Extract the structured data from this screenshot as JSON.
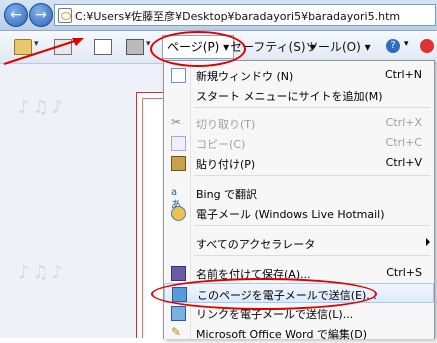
{
  "address_bar": {
    "url": "C:¥Users¥佐藤至彦¥Desktop¥baradayori5¥baradayori5.htm",
    "back_glyph": "←",
    "forward_glyph": "→"
  },
  "command_bar": {
    "page_menu_label": "ページ(P) ▾",
    "safety_menu_label": "セーフティ(S) ▾",
    "tools_menu_label": "ツール(O) ▾",
    "help_glyph": "?",
    "arrow_glyph": "▾"
  },
  "page": {
    "music_decor": "♪♫♪"
  },
  "page_menu": {
    "items": [
      {
        "label": "新規ウィンドウ (N)",
        "shortcut": "Ctrl+N",
        "icon": "new-window-icon",
        "disabled": false
      },
      {
        "label": "スタート メニューにサイトを追加(M)",
        "shortcut": "",
        "icon": "",
        "disabled": false
      },
      {
        "label": "切り取り(T)",
        "shortcut": "Ctrl+X",
        "icon": "cut-icon",
        "disabled": true
      },
      {
        "label": "コピー(C)",
        "shortcut": "Ctrl+C",
        "icon": "copy-icon",
        "disabled": true
      },
      {
        "label": "貼り付け(P)",
        "shortcut": "Ctrl+V",
        "icon": "paste-icon",
        "disabled": false
      },
      {
        "label": "Bing で翻訳",
        "shortcut": "",
        "icon": "translate-icon",
        "disabled": false
      },
      {
        "label": "電子メール (Windows Live Hotmail)",
        "shortcut": "",
        "icon": "email-accelerator-icon",
        "disabled": false
      },
      {
        "label": "すべてのアクセラレータ",
        "shortcut": "",
        "icon": "",
        "disabled": false
      },
      {
        "label": "名前を付けて保存(A)...",
        "shortcut": "Ctrl+S",
        "icon": "save-icon",
        "disabled": false
      },
      {
        "label": "このページを電子メールで送信(E)...",
        "shortcut": "",
        "icon": "send-page-icon",
        "disabled": false
      },
      {
        "label": "リンクを電子メールで送信(L)...",
        "shortcut": "",
        "icon": "send-link-icon",
        "disabled": false
      },
      {
        "label": "Microsoft Office Word で編集(D)",
        "shortcut": "",
        "icon": "word-edit-icon",
        "disabled": false
      }
    ]
  },
  "colors": {
    "annotation_red": "#e00000",
    "highlight_bg": "#dbe9fb"
  }
}
